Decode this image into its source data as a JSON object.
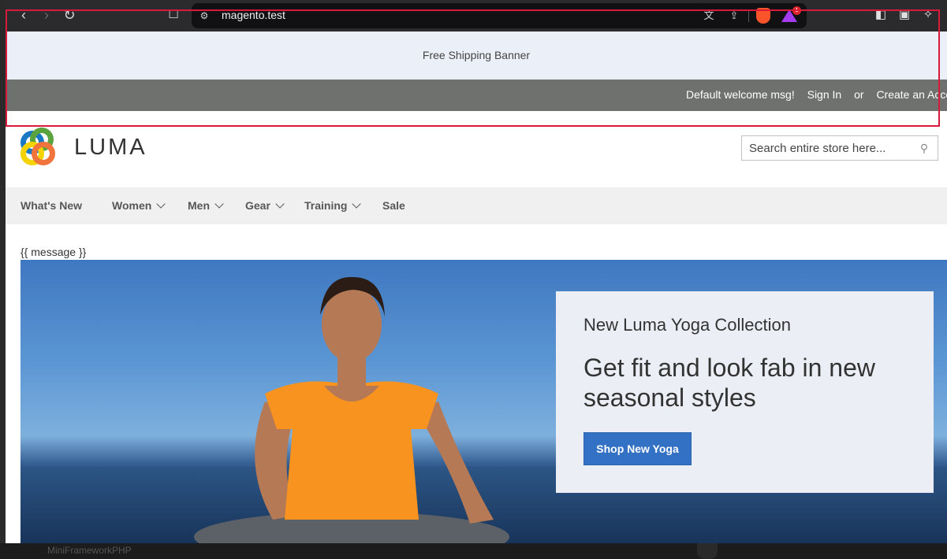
{
  "browser": {
    "url": "magento.test",
    "rewards_badge": "1"
  },
  "store": {
    "shipping_banner": "Free Shipping Banner",
    "header": {
      "welcome": "Default welcome msg!",
      "sign_in": "Sign In",
      "or": "or",
      "create_account": "Create an Acco"
    },
    "logo_text": "LUMA",
    "search": {
      "placeholder": "Search entire store here..."
    },
    "nav": [
      {
        "label": "What's New",
        "has_menu": false
      },
      {
        "label": "Women",
        "has_menu": true
      },
      {
        "label": "Men",
        "has_menu": true
      },
      {
        "label": "Gear",
        "has_menu": true
      },
      {
        "label": "Training",
        "has_menu": true
      },
      {
        "label": "Sale",
        "has_menu": false
      }
    ],
    "message": "{{ message }}",
    "hero": {
      "kicker": "New Luma Yoga Collection",
      "headline": "Get fit and look fab in new seasonal styles",
      "cta": "Shop New Yoga"
    }
  },
  "desktop": {
    "background_label": "MiniFrameworkPHP"
  },
  "colors": {
    "annotation_border": "#d81b3a",
    "cta_blue": "#3371c4",
    "header_panel": "#6e716e",
    "shipping_banner_bg": "#ebeff7"
  }
}
